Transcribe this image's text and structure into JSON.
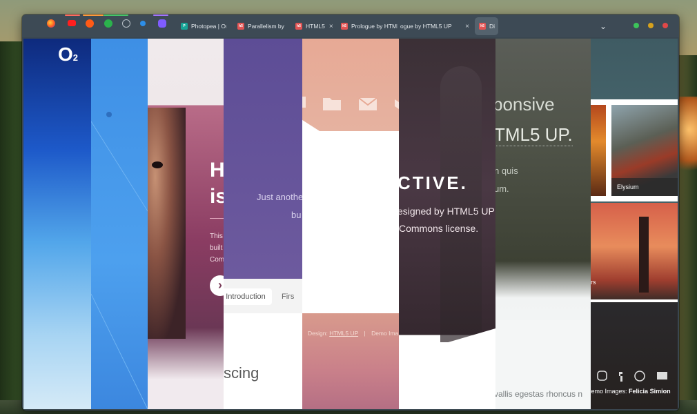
{
  "tabs": {
    "photopea_label": "Photopea | On",
    "parallelism_label": "Parallelism by",
    "html5_label": "HTML5",
    "prologue_label": "Prologue by HTML5",
    "prologue2_label": "ogue by HTML5 UP",
    "active_label": "Di",
    "close_glyph": "×",
    "menu_glyph": "⌄"
  },
  "o2": {
    "logo": "O",
    "sub": "2"
  },
  "hero": {
    "heading_1": "H",
    "heading_2": "is",
    "body_1": "This",
    "body_2": "built",
    "body_3": "Comm",
    "arrow": "›"
  },
  "parallelism": {
    "tagline_1": "Just another",
    "tagline_2": "bu",
    "nav_intro": "Introduction",
    "nav_first": "Firs",
    "big_word": "scing"
  },
  "prologue": {
    "credits_design": "Design:",
    "credits_link": "HTML5 UP",
    "credits_sep": "|",
    "credits_demo": "Demo Ima"
  },
  "dark_hero": {
    "title": "CTIVE.",
    "line_1": "esigned by HTML5 UP",
    "line_2": "Commons license."
  },
  "responsive": {
    "title": "ponsive",
    "title_2": "TML5 UP.",
    "line_1": "n quis",
    "line_2": "um.",
    "footer": "vallis egestas rhoncus n"
  },
  "gallery": {
    "card_elysium": "Elysium",
    "card_partial": "rs",
    "credit_label": "Demo Images:",
    "credit_name": "Felicia Simion"
  }
}
